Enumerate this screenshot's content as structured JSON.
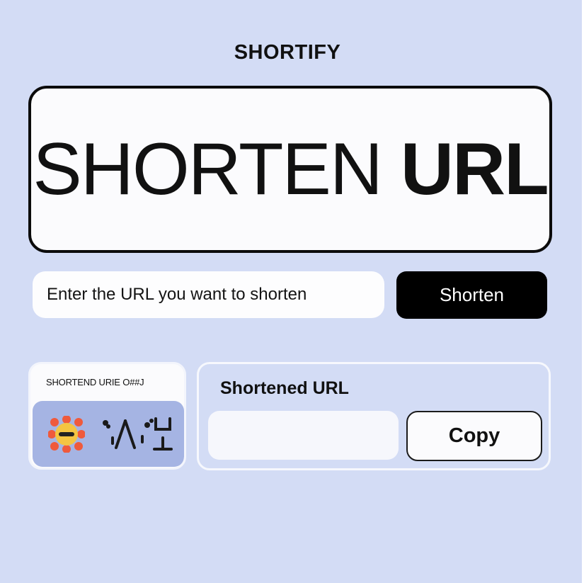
{
  "app": {
    "title": "SHORTIFY"
  },
  "hero": {
    "text_light": "SHORTEN ",
    "text_bold": "URL"
  },
  "form": {
    "url_placeholder": "Enter the URL you want to shorten",
    "shorten_label": "Shorten"
  },
  "thumbnail": {
    "caption": "SHORTEND URIE O##J",
    "icons": [
      "emoji-face-icon",
      "glyph-symbols-icon"
    ]
  },
  "result": {
    "title": "Shortened URL",
    "value": "",
    "copy_label": "Copy"
  },
  "colors": {
    "background": "#d3dcf5",
    "primary_button": "#000000",
    "thumb_image_bg": "#a5b4e3",
    "emoji_face": "#f4c542",
    "emoji_petals": "#ef5a3c"
  }
}
